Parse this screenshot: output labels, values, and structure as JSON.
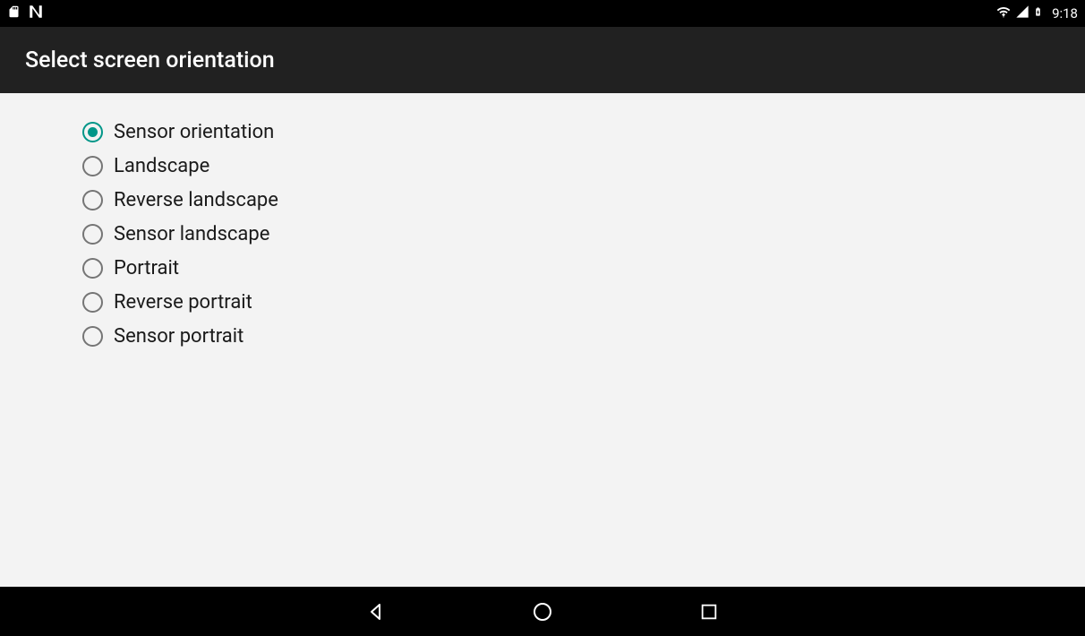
{
  "statusBar": {
    "clock": "9:18"
  },
  "appBar": {
    "title": "Select screen orientation"
  },
  "options": [
    {
      "label": "Sensor orientation",
      "selected": true
    },
    {
      "label": "Landscape",
      "selected": false
    },
    {
      "label": "Reverse landscape",
      "selected": false
    },
    {
      "label": "Sensor landscape",
      "selected": false
    },
    {
      "label": "Portrait",
      "selected": false
    },
    {
      "label": "Reverse portrait",
      "selected": false
    },
    {
      "label": "Sensor portrait",
      "selected": false
    }
  ],
  "colors": {
    "accent": "#009688",
    "appBar": "#212121",
    "background": "#f3f3f3"
  }
}
